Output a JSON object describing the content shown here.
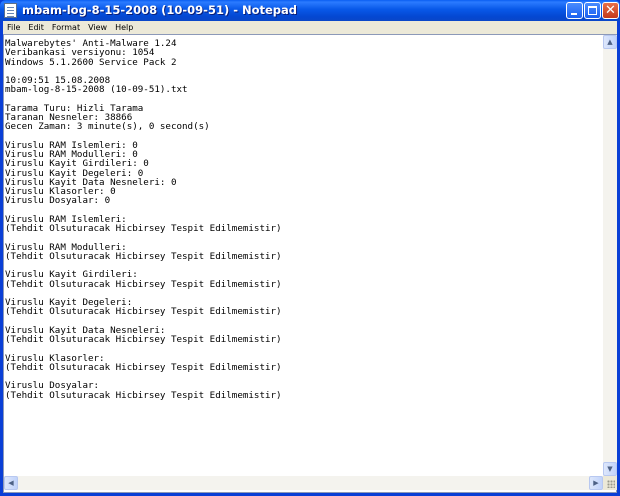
{
  "window": {
    "title": "mbam-log-8-15-2008 (10-09-51) - Notepad",
    "title_bar_color": "#0a47c8",
    "close_button_color": "#c4381a"
  },
  "menu": {
    "items": [
      "File",
      "Edit",
      "Format",
      "View",
      "Help"
    ]
  },
  "editor": {
    "lines": [
      "Malwarebytes' Anti-Malware 1.24",
      "Veribankasi versiyonu: 1054",
      "Windows 5.1.2600 Service Pack 2",
      "",
      "10:09:51 15.08.2008",
      "mbam-log-8-15-2008 (10-09-51).txt",
      "",
      "Tarama Turu: Hizli Tarama",
      "Taranan Nesneler: 38866",
      "Gecen Zaman: 3 minute(s), 0 second(s)",
      "",
      "Viruslu RAM Islemleri: 0",
      "Viruslu RAM Modulleri: 0",
      "Viruslu Kayit Girdileri: 0",
      "Viruslu Kayit Degeleri: 0",
      "Viruslu Kayit Data Nesneleri: 0",
      "Viruslu Klasorler: 0",
      "Viruslu Dosyalar: 0",
      "",
      "Viruslu RAM Islemleri:",
      "(Tehdit Olsuturacak Hicbirsey Tespit Edilmemistir)",
      "",
      "Viruslu RAM Modulleri:",
      "(Tehdit Olsuturacak Hicbirsey Tespit Edilmemistir)",
      "",
      "Viruslu Kayit Girdileri:",
      "(Tehdit Olsuturacak Hicbirsey Tespit Edilmemistir)",
      "",
      "Viruslu Kayit Degeleri:",
      "(Tehdit Olsuturacak Hicbirsey Tespit Edilmemistir)",
      "",
      "Viruslu Kayit Data Nesneleri:",
      "(Tehdit Olsuturacak Hicbirsey Tespit Edilmemistir)",
      "",
      "Viruslu Klasorler:",
      "(Tehdit Olsuturacak Hicbirsey Tespit Edilmemistir)",
      "",
      "Viruslu Dosyalar:",
      "(Tehdit Olsuturacak Hicbirsey Tespit Edilmemistir)"
    ]
  },
  "icons": {
    "app": "notepad-icon",
    "minimize": "minimize-icon",
    "maximize": "maximize-icon",
    "close": "close-icon",
    "scroll_up": "arrow-up-icon",
    "scroll_down": "arrow-down-icon",
    "scroll_left": "arrow-left-icon",
    "scroll_right": "arrow-right-icon",
    "grip": "resize-grip-icon"
  }
}
